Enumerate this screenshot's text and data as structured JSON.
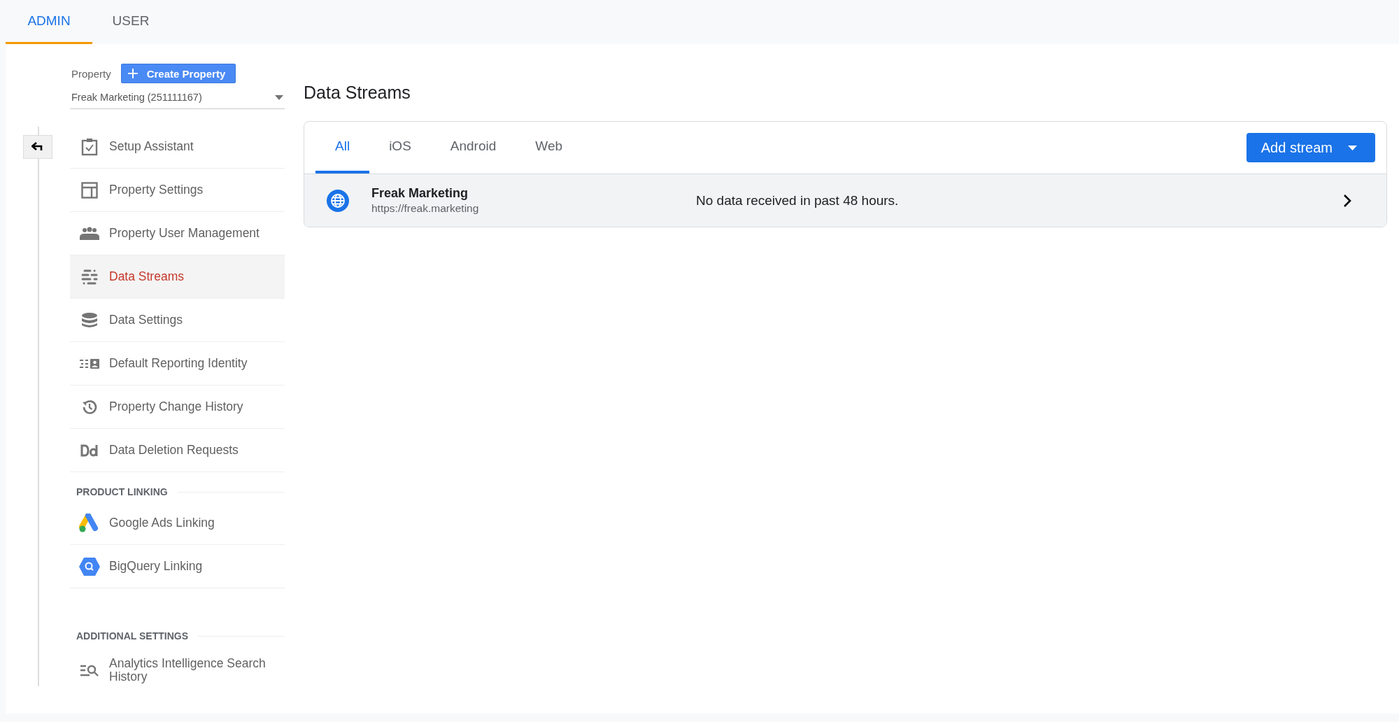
{
  "top_tabs": [
    {
      "label": "ADMIN",
      "selected": true
    },
    {
      "label": "USER",
      "selected": false
    }
  ],
  "property": {
    "label": "Property",
    "create_button": "Create Property",
    "value": "Freak Marketing (251111167)"
  },
  "sidebar": {
    "groups": [
      {
        "items": [
          {
            "label": "Setup Assistant",
            "selected": false
          },
          {
            "label": "Property Settings",
            "selected": false
          },
          {
            "label": "Property User Management",
            "selected": false
          },
          {
            "label": "Data Streams",
            "selected": true
          },
          {
            "label": "Data Settings",
            "selected": false
          },
          {
            "label": "Default Reporting Identity",
            "selected": false
          },
          {
            "label": "Property Change History",
            "selected": false
          },
          {
            "label": "Data Deletion Requests",
            "selected": false
          }
        ]
      },
      {
        "heading": "PRODUCT LINKING",
        "items": [
          {
            "label": "Google Ads Linking",
            "selected": false
          },
          {
            "label": "BigQuery Linking",
            "selected": false
          }
        ]
      },
      {
        "heading": "ADDITIONAL SETTINGS",
        "items": [
          {
            "label": "Analytics Intelligence Search History",
            "selected": false
          }
        ]
      }
    ]
  },
  "page_title": "Data Streams",
  "stream_tabs": [
    {
      "label": "All",
      "selected": true
    },
    {
      "label": "iOS",
      "selected": false
    },
    {
      "label": "Android",
      "selected": false
    },
    {
      "label": "Web",
      "selected": false
    }
  ],
  "add_button": "Add stream",
  "streams": [
    {
      "name": "Freak Marketing",
      "url": "https://freak.marketing",
      "status": "No data received in past 48 hours."
    }
  ]
}
